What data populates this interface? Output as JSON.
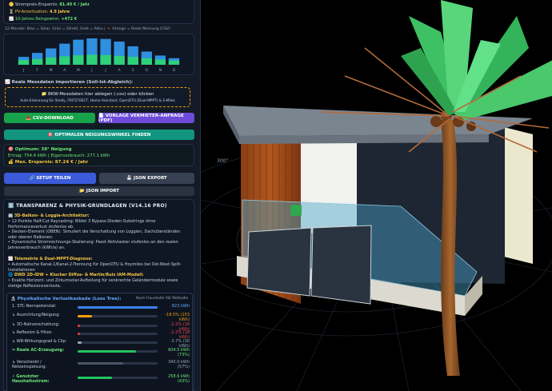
{
  "summary": {
    "savings_label": "Strompreis-Ersparnis:",
    "savings_value": "81.40 € / Jahr",
    "amort_label": "PV-Amortisation:",
    "amort_value": "4.9 Jahre",
    "gain_label": "10-Jahres Reingewinn:",
    "gain_value": "+472 €"
  },
  "monthly": {
    "legend": "12-Monate: Blau = Solar, Grün = Direkt, Gelb = Akku | 🔸 Orange = Reale Messung (CSV)",
    "months": [
      "J",
      "F",
      "M",
      "A",
      "M",
      "J",
      "J",
      "A",
      "S",
      "O",
      "N",
      "D"
    ],
    "solar": [
      0.3,
      0.45,
      0.62,
      0.8,
      0.95,
      1.0,
      0.98,
      0.88,
      0.7,
      0.5,
      0.35,
      0.25
    ],
    "direct": [
      0.18,
      0.22,
      0.28,
      0.32,
      0.36,
      0.38,
      0.37,
      0.34,
      0.3,
      0.25,
      0.2,
      0.16
    ]
  },
  "import": {
    "title": "Reale Messdaten importieren (Soll-Ist-Abgleich):",
    "drop_label": "📁 BKW-Messdaten hier ablegen (.csv) oder klicken",
    "drop_sub": "Auto-Erkennung für Shelly, FRITZ!DECT, Home Assistant, OpenDTU (Dual-MPPT) & S-Miles"
  },
  "buttons": {
    "csv": "📥 CSV-DOWNLOAD",
    "landlord": "📄 VORLAGE VERMIETER-ANFRAGE (PDF)",
    "optimal": "🎯 OPTIMALEN NEIGUNGSWINKEL FINDEN",
    "share": "🔗 SETUP TEILEN",
    "json_export": "💾 JSON EXPORT",
    "json_import": "📂 JSON IMPORT"
  },
  "optimum": {
    "line1": "🎯 Optimum: 38° Neigung",
    "line2": "Ertrag: 754.4 kWh | Eigenverbrauch: 277.1 kWh",
    "line3": "💰 Max. Ersparnis: 87.24 € / Jahr"
  },
  "transparency": {
    "title": "ℹ️ TRANSPARENZ & PHYSIK-GRUNDLAGEN (V14.16 PRO)",
    "sec1_title": "3D-Balkon- & Loggia-Architektur:",
    "sec1_l1": "• 12-Punkte Half-Cut Raycasting: Bildet 3 Bypass-Dioden-Substrings ohne Performanceverlust stufenlos ab.",
    "sec1_l2": "• Decken-Element (OBEN): Simuliert die Verschattung von Loggien, Dachüberständen oder oberen Balkonen.",
    "sec1_l3": "• Dynamische Stromrechnungs-Skalierung: Passt Aktivlasten stufenlos an den realen Jahresverbrauch (kWh/a) an.",
    "sec2_title": "Telemetrie & Dual-MPPT-Diagnose:",
    "sec2_l1": "• Automatische Kanal-1/Kanal-2-Trennung für OpenDTU & Hoymiles bei Ost-West-Split-Installationen",
    "sec3_title": "DWD 2D-IDW + Klucher Diffus- & Martin/Ruiz IAM-Modell:",
    "sec3_l1": "• Exakte Horizont- und Zirkumsolar-Aufteilung für senkrechte Geländermodule sowie stetige Reflexionsverluste."
  },
  "loss": {
    "title": "Physikalische Verlustkaskade (Loss Tree):",
    "method": "Nach Fraunhofer ISE Methodik",
    "rows": [
      {
        "label": "1. STC-Nennpotenzial:",
        "value": "823 kWh",
        "fill": 1.0,
        "color": "#3b82f6",
        "vcolor": "#62a8ff"
      },
      {
        "label": "↳ Ausrichtung/Neigung:",
        "value": "-18.5% (153 kWh)",
        "fill": 0.18,
        "color": "#f59e0b",
        "vcolor": "#f59e0b"
      },
      {
        "label": "↳ 3D-Nahverschattung:",
        "value": "-2.2% (18 kWh)",
        "fill": 0.03,
        "color": "#ef4444",
        "vcolor": "#ef4444"
      },
      {
        "label": "↳ Reflexion & Hitze:",
        "value": "-2.2% (18 kWh)",
        "fill": 0.03,
        "color": "#ef4444",
        "vcolor": "#ef4444"
      },
      {
        "label": "↳ WR-Wirkungsgrad & Clip:",
        "value": "-3.7% (30 kWh)",
        "fill": 0.05,
        "color": "#9aa7bb",
        "vcolor": "#9aa7bb"
      },
      {
        "label": "= Reale AC-Erzeugung:",
        "value": "604.5 kWh (73%)",
        "fill": 0.73,
        "color": "#22c55e",
        "vcolor": "#6ee77a"
      },
      {
        "label": "↳ Verschenkt / Netzeinspeisung:",
        "value": "345.0 kWh (57%)",
        "fill": 0.57,
        "color": "#4b5566",
        "vcolor": "#9aa7bb"
      },
      {
        "label": "⚡ Genutzter Haushaltsstrom:",
        "value": "258.6 kWh (43%)",
        "fill": 0.43,
        "color": "#22c55e",
        "vcolor": "#6ee77a"
      }
    ]
  },
  "scene": {
    "compass_label": "300°"
  }
}
